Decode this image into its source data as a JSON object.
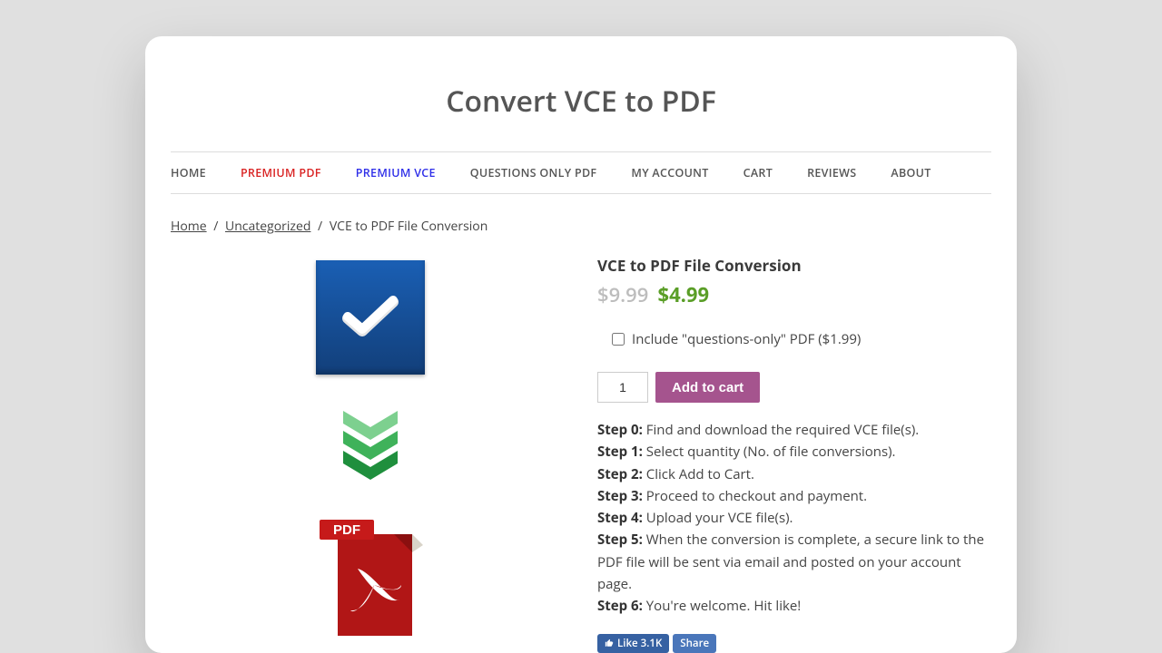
{
  "site_title": "Convert VCE to PDF",
  "nav": [
    {
      "label": "HOME",
      "cls": ""
    },
    {
      "label": "PREMIUM PDF",
      "cls": "red"
    },
    {
      "label": "PREMIUM VCE",
      "cls": "blue"
    },
    {
      "label": "QUESTIONS ONLY PDF",
      "cls": ""
    },
    {
      "label": "MY ACCOUNT",
      "cls": ""
    },
    {
      "label": "CART",
      "cls": ""
    },
    {
      "label": "REVIEWS",
      "cls": ""
    },
    {
      "label": "ABOUT",
      "cls": ""
    }
  ],
  "breadcrumb": {
    "home": "Home",
    "cat": "Uncategorized",
    "current": "VCE to PDF File Conversion"
  },
  "product": {
    "title": "VCE to PDF File Conversion",
    "old_price": "$9.99",
    "new_price": "$4.99",
    "addon_label": "Include \"questions-only\" PDF ($1.99)",
    "qty": "1",
    "add_label": "Add to cart",
    "pdf_badge": "PDF"
  },
  "steps": [
    {
      "k": "Step 0:",
      "v": "Find and download the required VCE file(s)."
    },
    {
      "k": "Step 1:",
      "v": "Select quantity (No. of file conversions)."
    },
    {
      "k": "Step 2:",
      "v": "Click Add to Cart."
    },
    {
      "k": "Step 3:",
      "v": "Proceed to checkout and payment."
    },
    {
      "k": "Step 4:",
      "v": "Upload your VCE file(s)."
    },
    {
      "k": "Step 5:",
      "v": "When the conversion is complete, a secure link to the PDF file will be sent via email and posted on your account page."
    },
    {
      "k": "Step 6:",
      "v": "You're welcome. Hit like!"
    }
  ],
  "fb": {
    "like": "Like 3.1K",
    "share": "Share"
  }
}
